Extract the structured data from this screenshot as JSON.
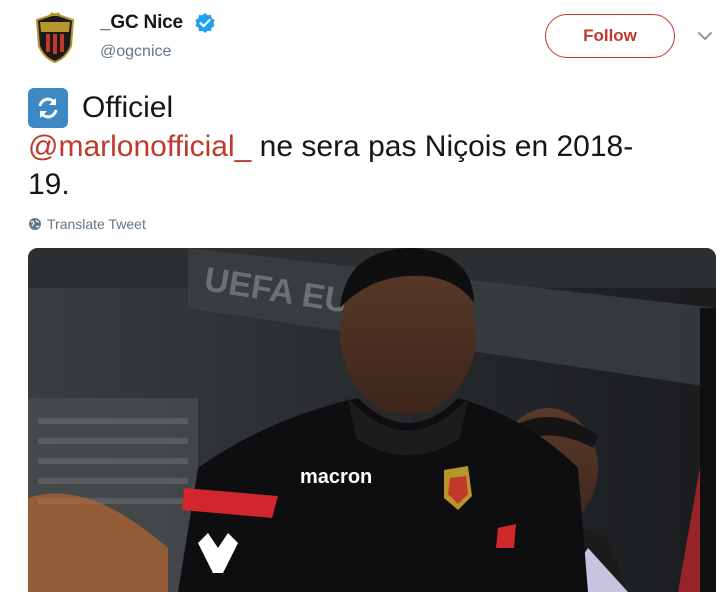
{
  "tweet": {
    "display_name": "_GC Nice",
    "handle": "@ogcnice",
    "verified_icon": "verified-badge-icon",
    "follow_label": "Follow",
    "line1": "Officiel",
    "mention": "@marlonofficial_",
    "body_rest": " ne sera pas Niçois en 2018-",
    "body_end": "19.",
    "translate_label": "Translate Tweet",
    "emoji_icon": "repeat-arrows-icon"
  },
  "media": {
    "banner_text": "UEFA EU",
    "shirt_brand": "macron",
    "description": "photo"
  },
  "colors": {
    "accent": "#c0392b",
    "verified": "#1da1f2",
    "secondary_text": "#657786"
  }
}
